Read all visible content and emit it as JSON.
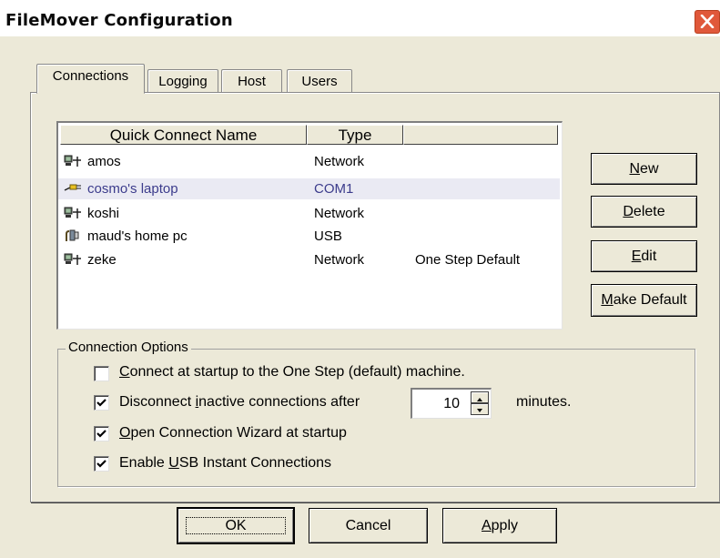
{
  "window": {
    "title": "FileMover Configuration"
  },
  "tabs": [
    {
      "label": "Connections",
      "active": true
    },
    {
      "label": "Logging",
      "active": false
    },
    {
      "label": "Host",
      "active": false
    },
    {
      "label": "Users",
      "active": false
    }
  ],
  "list": {
    "headers": [
      "Quick Connect Name",
      "Type",
      ""
    ],
    "rows": [
      {
        "name": "amos",
        "type": "Network",
        "note": "",
        "icon": "network-computer-icon",
        "selected": false
      },
      {
        "name": "cosmo's laptop",
        "type": "COM1",
        "note": "",
        "icon": "serial-cable-icon",
        "selected": true
      },
      {
        "name": "koshi",
        "type": "Network",
        "note": "",
        "icon": "network-computer-icon",
        "selected": false
      },
      {
        "name": "maud's home pc",
        "type": "USB",
        "note": "",
        "icon": "usb-plug-icon",
        "selected": false
      },
      {
        "name": "zeke",
        "type": "Network",
        "note": "One Step Default",
        "icon": "network-computer-icon",
        "selected": false
      }
    ]
  },
  "side_buttons": {
    "new": {
      "pre": "",
      "key": "N",
      "post": "ew"
    },
    "delete": {
      "pre": "",
      "key": "D",
      "post": "elete"
    },
    "edit": {
      "pre": "",
      "key": "E",
      "post": "dit"
    },
    "make_default": {
      "pre": "",
      "key": "M",
      "post": "ake Default"
    }
  },
  "options": {
    "group_label": "Connection Options",
    "items": [
      {
        "pre": "",
        "key": "C",
        "post": "onnect at startup to the One Step (default) machine.",
        "checked": false
      },
      {
        "pre": "Disconnect ",
        "key": "i",
        "post": "nactive connections after",
        "checked": true
      },
      {
        "pre": "",
        "key": "O",
        "post": "pen Connection Wizard at startup",
        "checked": true
      },
      {
        "pre": "Enable ",
        "key": "U",
        "post": "SB Instant Connections",
        "checked": true
      }
    ],
    "timeout_value": "10",
    "timeout_unit": "minutes."
  },
  "footer": {
    "ok": "OK",
    "cancel": "Cancel",
    "apply": {
      "pre": "",
      "key": "A",
      "post": "pply"
    }
  },
  "colors": {
    "selected_row_text": "#3c3c8c",
    "selected_row_bg": "#eaeaf3",
    "close_button": "#e0583a",
    "dialog_bg": "#ece9d8"
  }
}
